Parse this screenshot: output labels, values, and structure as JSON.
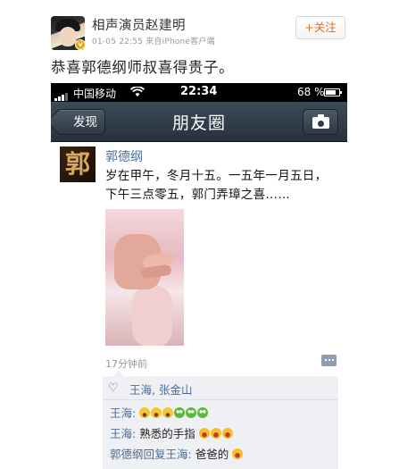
{
  "weibo": {
    "username": "相声演员赵建明",
    "timestamp": "01-05 22:55",
    "source": "来自iPhone客户端",
    "follow_label": "+关注",
    "verified_badge": "v",
    "post_text": "恭喜郭德纲师叔喜得贵子。"
  },
  "screenshot": {
    "status_bar": {
      "carrier": "中国移动",
      "time": "22:34",
      "battery": "68 %"
    },
    "nav": {
      "back_label": "发现",
      "title": "朋友圈",
      "camera_icon": "camera-icon"
    },
    "moment": {
      "avatar_glyph": "郭",
      "author": "郭德纲",
      "content": "岁在甲午，冬月十五。一五年一月五日，下午三点零五，郭门弄璋之喜……",
      "time": "17分钟前",
      "likes": "王海, 张金山",
      "comments": [
        {
          "author": "王海:",
          "text": "",
          "emojis": [
            "shock",
            "shock",
            "shock",
            "frog",
            "frog",
            "frog"
          ]
        },
        {
          "author": "王海:",
          "text": " 熟悉的手指",
          "emojis": [
            "laugh",
            "laugh",
            "laugh"
          ]
        },
        {
          "author": "郭德纲回复王海:",
          "text": " 爸爸的",
          "emojis": [
            "laugh"
          ]
        }
      ]
    }
  },
  "colors": {
    "link_blue": "#4a6b9a",
    "follow_orange": "#e86b15",
    "nav_dark": "#27323d"
  }
}
